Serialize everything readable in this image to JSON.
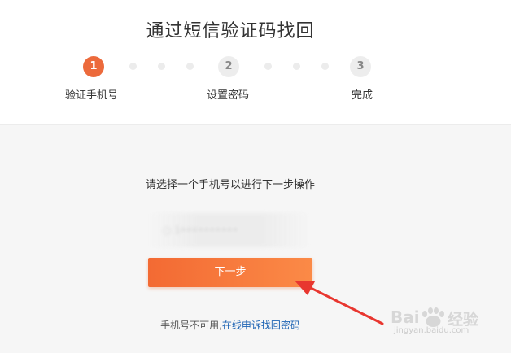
{
  "page": {
    "title": "通过短信验证码找回"
  },
  "steps": [
    {
      "number": "1",
      "label": "验证手机号",
      "state": "active"
    },
    {
      "number": "2",
      "label": "设置密码",
      "state": "inactive"
    },
    {
      "number": "3",
      "label": "完成",
      "state": "inactive"
    }
  ],
  "main": {
    "instruction": "请选择一个手机号以进行下一步操作",
    "phone_option": "○ 1••••••••••",
    "next_label": "下一步"
  },
  "footer": {
    "text": "手机号不可用,",
    "link": "在线申诉找回密码"
  },
  "watermark": {
    "logo_text": "Bai",
    "cn_text": "经验",
    "url": "jingyan.baidu.com"
  },
  "colors": {
    "accent": "#ec6a3c",
    "button_start": "#f36a33",
    "button_end": "#fb8a47",
    "link": "#1e64b4",
    "annotation_arrow": "#e8362f"
  }
}
